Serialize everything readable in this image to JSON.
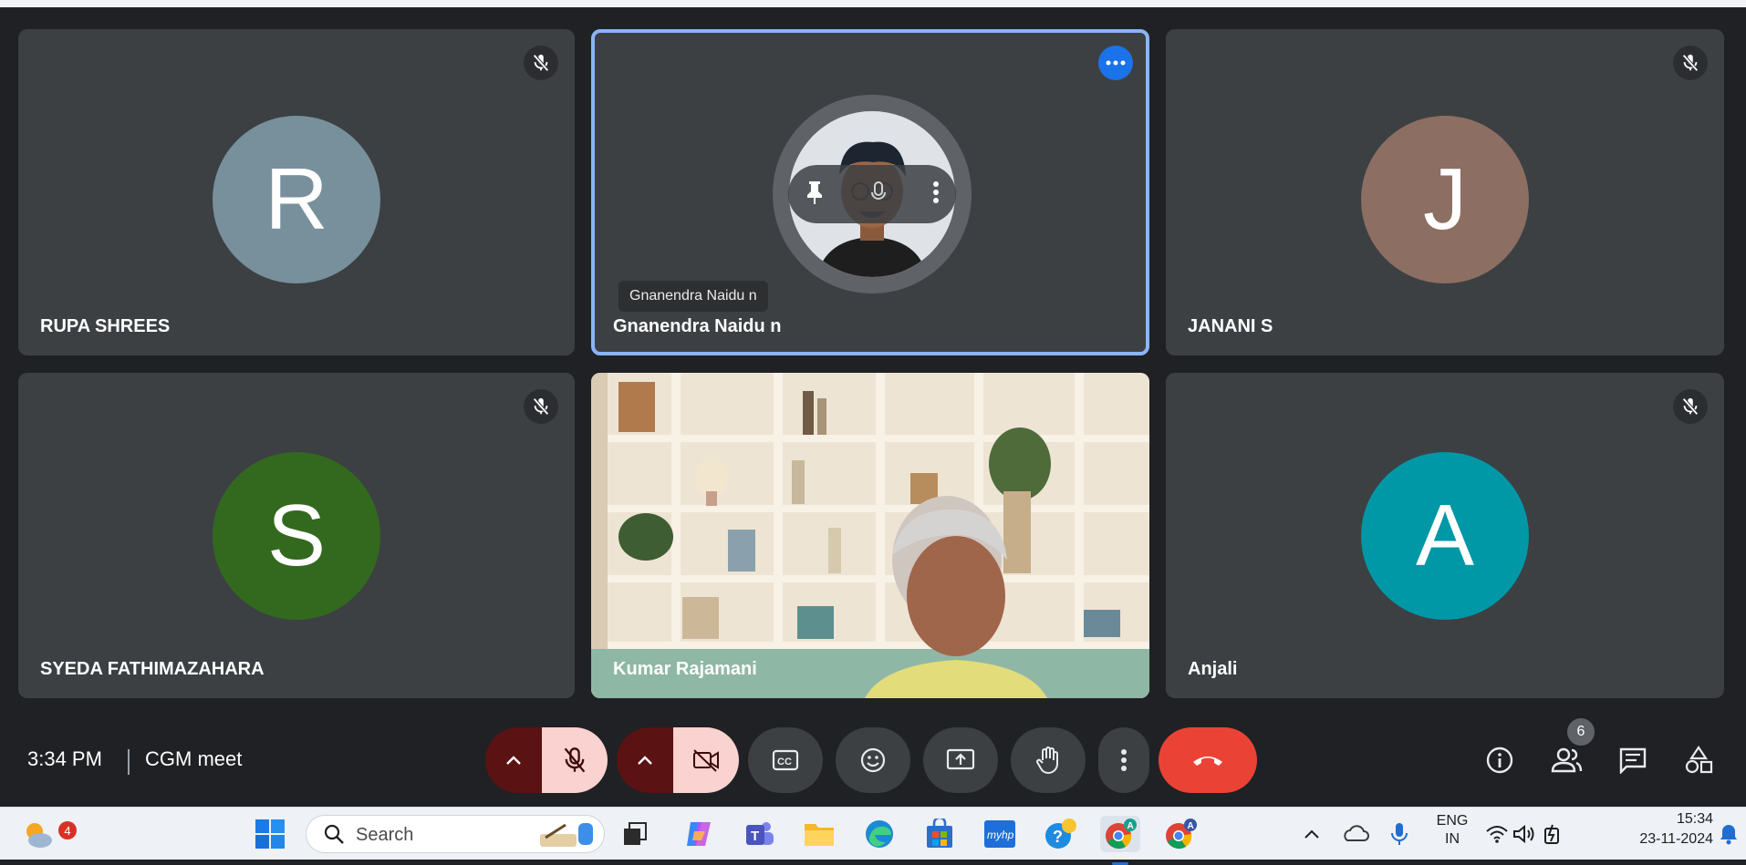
{
  "participants": {
    "rupa": {
      "initial": "R",
      "name": "RUPA SHREES",
      "color": "#78909c"
    },
    "gnanendra": {
      "name": "Gnanendra Naidu n",
      "tooltip": "Gnanendra Naidu n"
    },
    "janani": {
      "initial": "J",
      "name": "JANANI S",
      "color": "#8d6e63"
    },
    "syeda": {
      "initial": "S",
      "name": "SYEDA FATHIMAZAHARA",
      "color": "#33691e"
    },
    "kumar": {
      "name": "Kumar Rajamani"
    },
    "anjali": {
      "initial": "A",
      "name": "Anjali",
      "color": "#0097a7"
    }
  },
  "meeting": {
    "time": "3:34 PM",
    "title": "CGM meet",
    "people_count": "6"
  },
  "icons": {
    "mic_off": "mic-off-icon",
    "camera_off": "camera-off-icon",
    "captions": "captions-icon",
    "emoji": "emoji-icon",
    "present": "present-icon",
    "raise_hand": "raise-hand-icon",
    "more": "more-vert-icon",
    "end_call": "end-call-icon",
    "info": "info-icon",
    "people": "people-icon",
    "chat": "chat-icon",
    "activities": "activities-icon"
  },
  "taskbar": {
    "search_label": "Search",
    "weather_badge": "4",
    "lang_line1": "ENG",
    "lang_line2": "IN",
    "clock_time": "15:34",
    "clock_date": "23-11-2024",
    "myhp_label": "myhp",
    "chrome_profile": "A"
  },
  "colors": {
    "accent_blue": "#8ab4f8",
    "end_call_red": "#ea4335",
    "muted_red_bg": "#fad2cf",
    "dark_red": "#5b1212"
  }
}
